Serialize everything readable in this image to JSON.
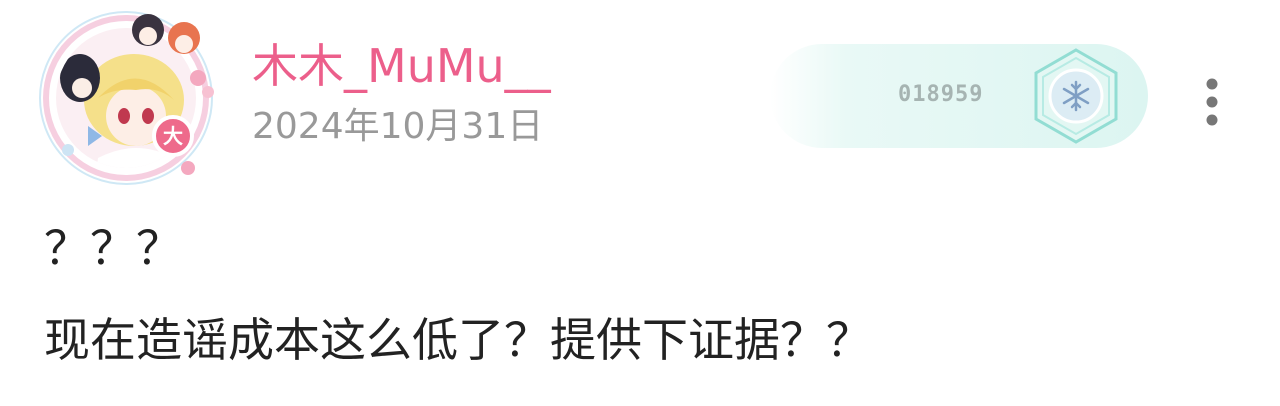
{
  "user": {
    "name": "木木_MuMu__",
    "avatar_badge": "大",
    "name_color": "#ec5f8b"
  },
  "post": {
    "date": "2024年10月31日"
  },
  "fan_medal": {
    "number": "018959",
    "icon": "snowflake-hexagon-icon",
    "color": "#7fd9cf"
  },
  "actions": {
    "more_icon": "more-vertical-icon"
  },
  "comment": {
    "lines": [
      "？？？",
      "现在造谣成本这么低了？提供下证据？？"
    ]
  }
}
